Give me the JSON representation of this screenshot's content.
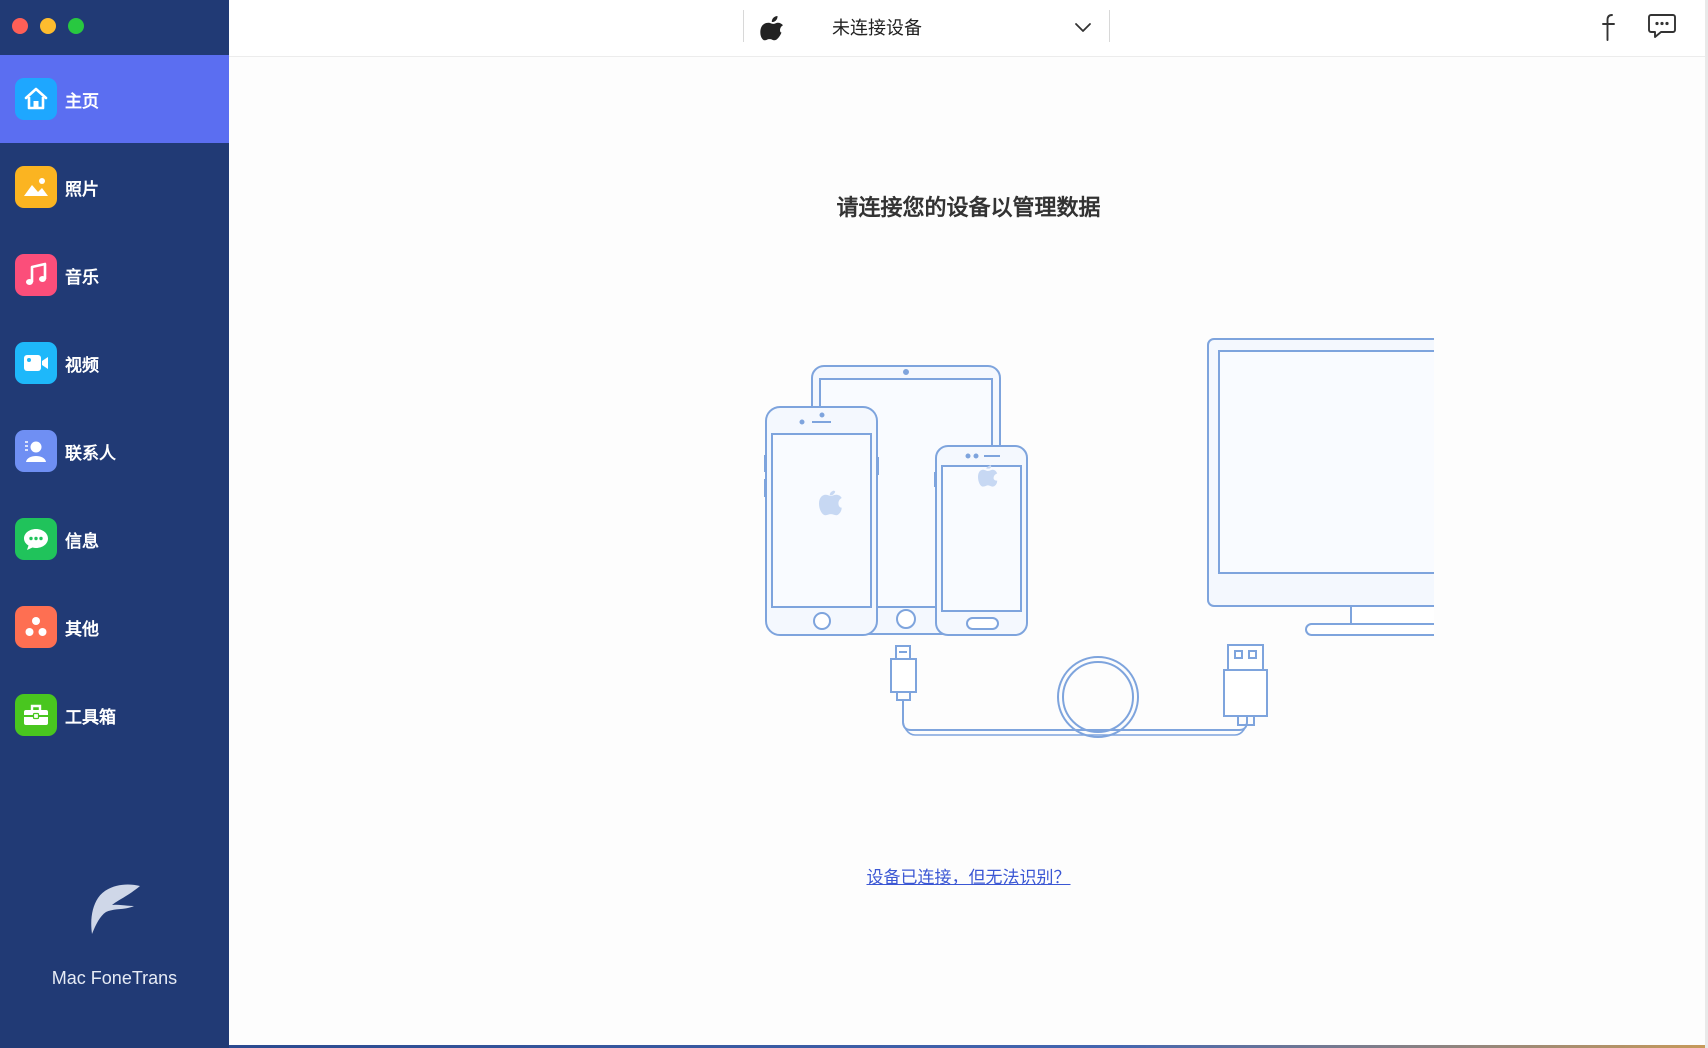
{
  "sidebar": {
    "items": [
      {
        "label": "主页",
        "icon": "home-icon",
        "color": "#1ea7ff",
        "active": true
      },
      {
        "label": "照片",
        "icon": "photo-icon",
        "color": "#fbb421",
        "active": false
      },
      {
        "label": "音乐",
        "icon": "music-icon",
        "color": "#fb4e7a",
        "active": false
      },
      {
        "label": "视频",
        "icon": "video-icon",
        "color": "#1eb8fa",
        "active": false
      },
      {
        "label": "联系人",
        "icon": "contacts-icon",
        "color": "#6f8ff3",
        "active": false
      },
      {
        "label": "信息",
        "icon": "message-icon",
        "color": "#20c35b",
        "active": false
      },
      {
        "label": "其他",
        "icon": "others-icon",
        "color": "#fe6f52",
        "active": false
      },
      {
        "label": "工具箱",
        "icon": "toolbox-icon",
        "color": "#49c61f",
        "active": false
      }
    ],
    "app_name": "Mac FoneTrans"
  },
  "topbar": {
    "device_status": "未连接设备",
    "accent": "#5b6ef1"
  },
  "main": {
    "headline": "请连接您的设备以管理数据",
    "help_link": "设备已连接，但无法识别？"
  }
}
